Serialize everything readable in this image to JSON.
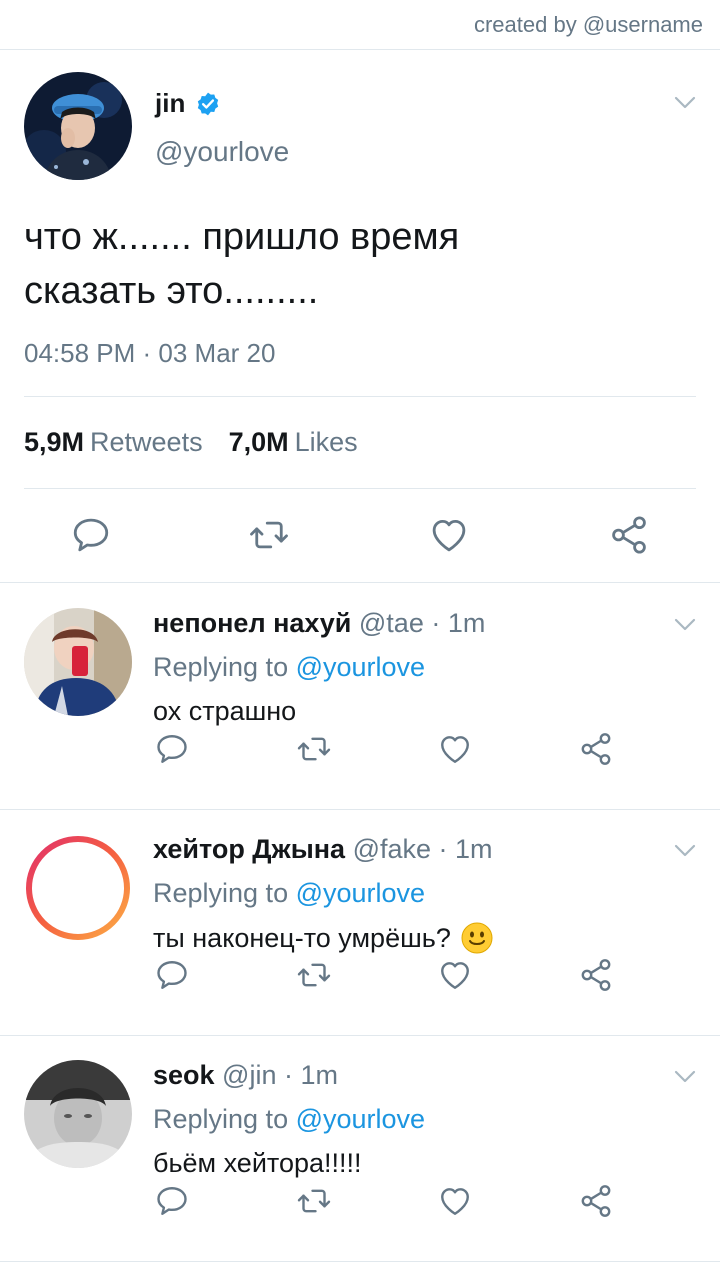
{
  "header": {
    "credit": "created by @username"
  },
  "tweet": {
    "name": "jin",
    "handle": "@yourlove",
    "text_line1": "что ж....... пришло время",
    "text_line2": "сказать это.........",
    "timestamp": "04:58 PM · 03 Mar 20",
    "retweets_count": "5,9M",
    "retweets_label": "Retweets",
    "likes_count": "7,0M",
    "likes_label": "Likes"
  },
  "replies": [
    {
      "name": "непонел нахуй",
      "meta": " @tae · 1m",
      "replying_prefix": "Replying to ",
      "replying_to": "@yourlove",
      "text": "ох страшно"
    },
    {
      "name": "хейтор Джына",
      "meta": " @fake · 1m",
      "replying_prefix": "Replying to ",
      "replying_to": "@yourlove",
      "text": "ты наконец-то умрёшь?"
    },
    {
      "name": "seok",
      "meta": " @jin · 1m",
      "replying_prefix": "Replying to ",
      "replying_to": "@yourlove",
      "text": "бьём хейтора!!!!!"
    }
  ],
  "icons": {
    "reply": "reply-icon",
    "retweet": "retweet-icon",
    "like": "heart-icon",
    "share": "share-icon",
    "more": "chevron-down-icon",
    "verified": "verified-badge-icon"
  },
  "colors": {
    "text": "#14171a",
    "secondary": "#657786",
    "link": "#1b95e0",
    "verified": "#1da1f2",
    "divider": "#e1e8ed",
    "ring_gradient": [
      "#f56040",
      "#e1306c",
      "#fcaf45"
    ]
  }
}
